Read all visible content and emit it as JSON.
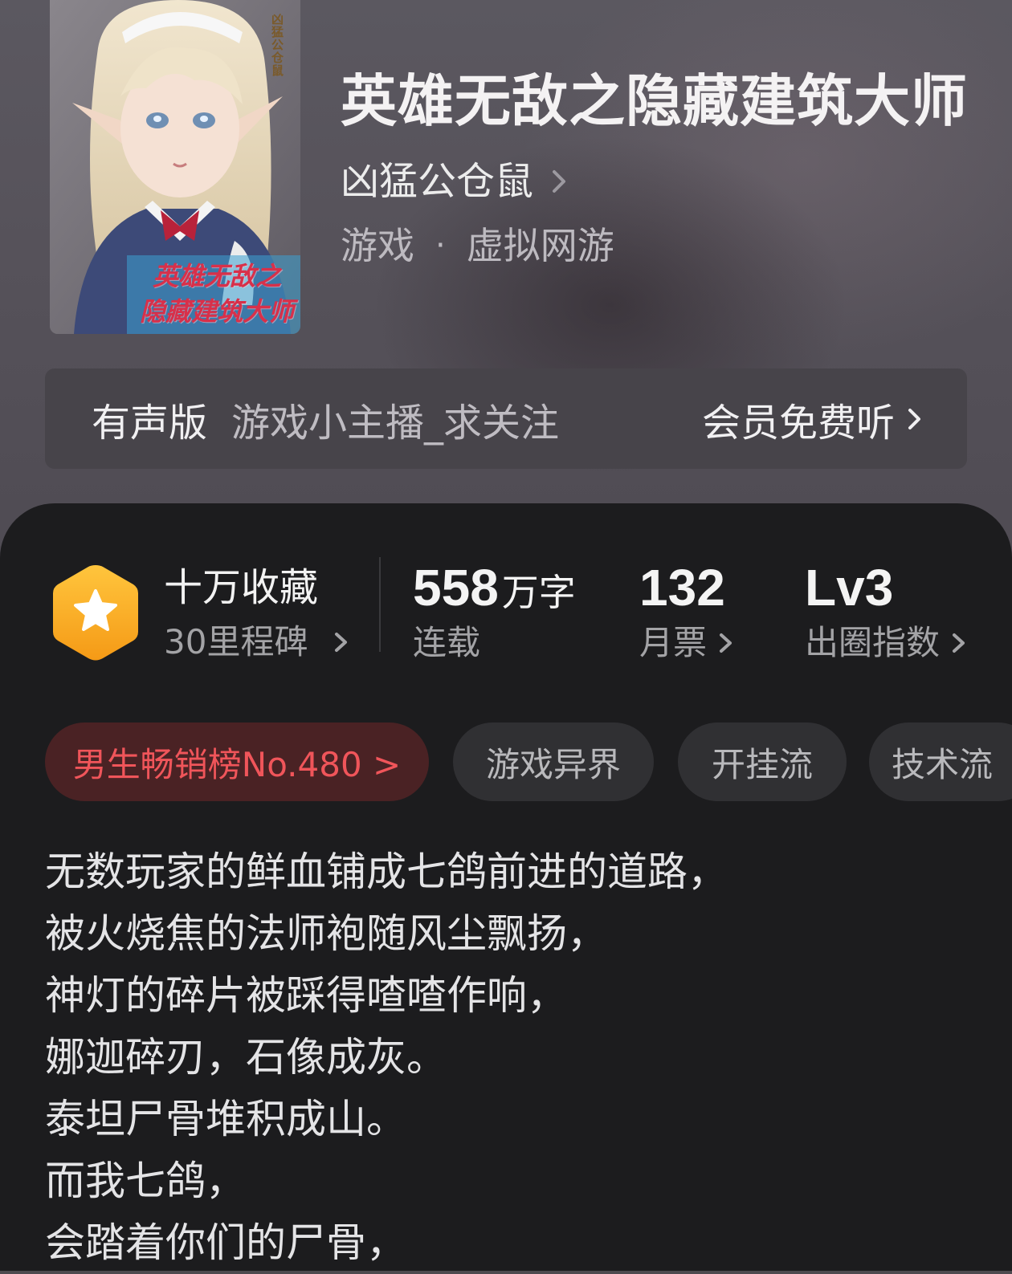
{
  "book": {
    "title": "英雄无敌之隐藏建筑大师",
    "author": "凶猛公仓鼠",
    "category": "游戏",
    "subcategory": "虚拟网游",
    "cover": {
      "title_line1": "英雄无敌之",
      "title_line2": "隐藏建筑大师",
      "author_stamp": "凶猛公仓鼠"
    }
  },
  "audio": {
    "label": "有声版",
    "narrator": "游戏小主播_求关注",
    "vip_text": "会员免费听"
  },
  "stats": {
    "collect_title": "十万收藏",
    "collect_sub": "30里程碑",
    "words_value": "558",
    "words_unit": "万字",
    "words_label": "连载",
    "tickets_value": "132",
    "tickets_label": "月票",
    "level_value": "Lv3",
    "level_label": "出圈指数"
  },
  "tags": {
    "rank": "男生畅销榜No.480 >",
    "items": [
      "游戏异界",
      "开挂流",
      "技术流"
    ]
  },
  "synopsis": [
    "无数玩家的鲜血铺成七鸽前进的道路，",
    "被火烧焦的法师袍随风尘飘扬，",
    "神灯的碎片被踩得喳喳作响，",
    "娜迦碎刃，石像成灰。",
    "泰坦尸骨堆积成山。",
    "而我七鸽，",
    "会踏着你们的尸骨，"
  ],
  "colors": {
    "panel": "#1c1c1e",
    "accent_red": "#f0555a",
    "badge_orange": "#f5a623"
  },
  "icons": [
    "chevron-right-icon",
    "star-badge-icon"
  ]
}
